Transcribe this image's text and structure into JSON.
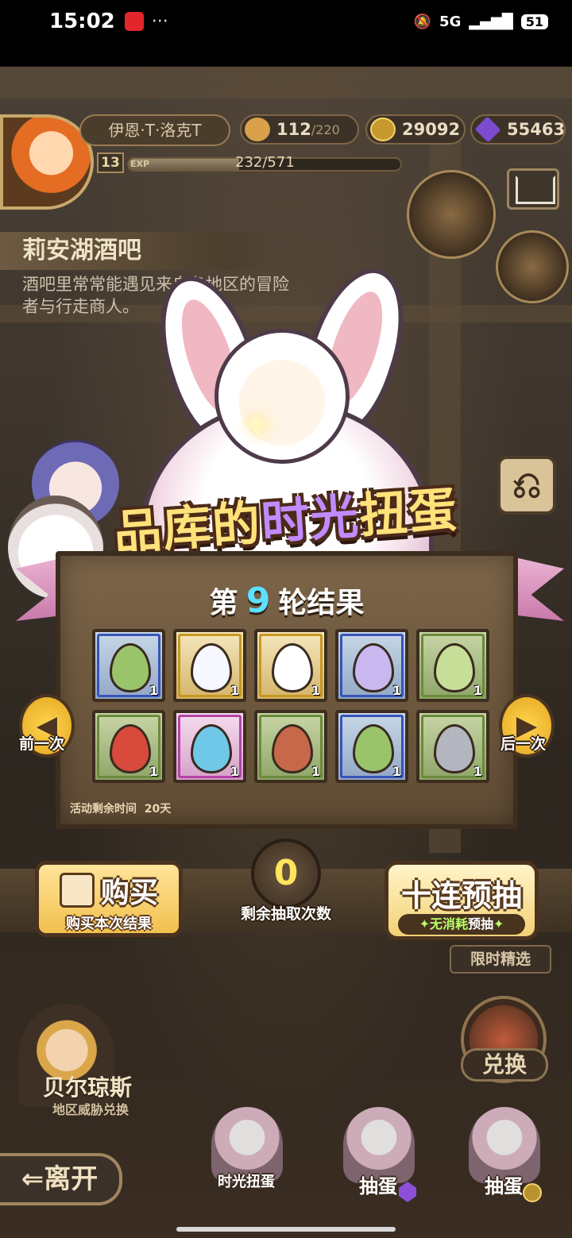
{
  "status_bar": {
    "time": "15:02",
    "signal": "5G",
    "battery": "51"
  },
  "player": {
    "name": "伊恩·T·洛克T",
    "level": "13",
    "exp_label": "EXP",
    "exp_text": "232/571",
    "exp_fraction": 0.406
  },
  "resources": {
    "stamina": "112",
    "stamina_max": "/220",
    "gold": "29092",
    "gems": "55463"
  },
  "location": {
    "title": "莉安湖酒吧",
    "description": "酒吧里常常能遇见来自各地区的冒险者与行走商人。"
  },
  "banner": {
    "part1": "品库的",
    "part2": "时光",
    "part3": "扭蛋"
  },
  "results": {
    "prefix": "第",
    "round": "9",
    "suffix": "轮结果",
    "items": [
      {
        "rarity": "blue",
        "name": "cabbage-egg",
        "qty": "1",
        "color": "#9ac46b"
      },
      {
        "rarity": "gold",
        "name": "angel-rainbow-egg",
        "qty": "1",
        "color": "#f6f7ff"
      },
      {
        "rarity": "gold",
        "name": "angel-halo-egg",
        "qty": "1",
        "color": "#ffffff"
      },
      {
        "rarity": "blue",
        "name": "purple-slime-egg",
        "qty": "1",
        "color": "#c9b8f0"
      },
      {
        "rarity": "green",
        "name": "scarf-green-egg",
        "qty": "1",
        "color": "#c7de98"
      },
      {
        "rarity": "green",
        "name": "red-swirl-egg",
        "qty": "1",
        "color": "#d84a3c"
      },
      {
        "rarity": "pink",
        "name": "water-drop-egg",
        "qty": "1",
        "color": "#6fc8e8"
      },
      {
        "rarity": "green",
        "name": "rock-volcano-egg",
        "qty": "1",
        "color": "#c8684a"
      },
      {
        "rarity": "blue",
        "name": "cabbage-egg",
        "qty": "1",
        "color": "#9ac46b"
      },
      {
        "rarity": "green",
        "name": "stone-spiral-egg",
        "qty": "1",
        "color": "#b4b6bf"
      }
    ],
    "timer_label": "活动剩余时间",
    "timer_value": "20天"
  },
  "nav": {
    "prev": "前一次",
    "next": "后一次"
  },
  "actions": {
    "buy_title": "购买",
    "buy_sub": "购买本次结果",
    "draws_left": "0",
    "draws_label": "剩余抽取次数",
    "ten_title": "十连预抽",
    "ten_sub_a": "无消耗",
    "ten_sub_b": "预抽",
    "limited": "限时精选"
  },
  "npc": {
    "name": "贝尔琼斯",
    "desc": "地区威胁兑换"
  },
  "bottom": {
    "exchange": "兑换",
    "leave": "离开",
    "tab_time": "时光扭蛋",
    "tab_gem": "抽蛋",
    "tab_gold": "抽蛋"
  },
  "colors": {
    "accent_gold": "#ffe27a",
    "accent_purple": "#c08bff",
    "round_number": "#5ce0ff"
  }
}
